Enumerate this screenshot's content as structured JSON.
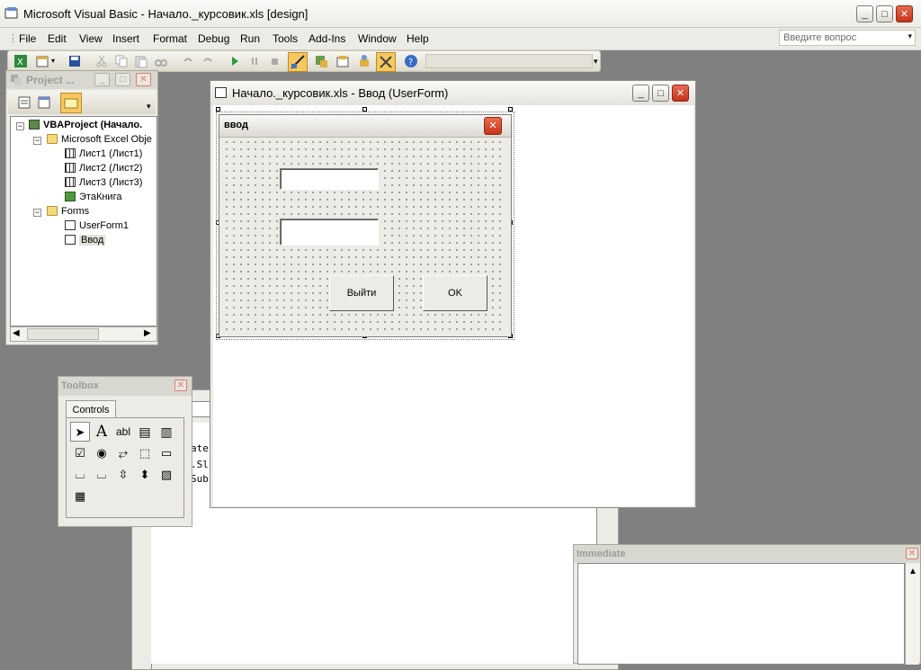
{
  "app": {
    "title": "Microsoft Visual Basic - Начало._курсовик.xls [design]"
  },
  "menu": {
    "items": [
      "File",
      "Edit",
      "View",
      "Insert",
      "Format",
      "Debug",
      "Run",
      "Tools",
      "Add-Ins",
      "Window",
      "Help"
    ],
    "ask_placeholder": "Введите вопрос"
  },
  "project": {
    "title": "Project ...",
    "tree": {
      "root": "VBAProject (Начало.",
      "excel_objects": "Microsoft Excel Obje",
      "sheet1": "Лист1 (Лист1)",
      "sheet2": "Лист2 (Лист2)",
      "sheet3": "Лист3 (Лист3)",
      "workbook": "ЭтаКнига",
      "forms": "Forms",
      "userform1": "UserForm1",
      "vvod": "Ввод"
    }
  },
  "designer": {
    "title": "Начало._курсовик.xls - Ввод (UserForm)",
    "form": {
      "caption": "ввод",
      "button_exit": "Выйти",
      "button_ok": "OK"
    }
  },
  "toolbox": {
    "title": "Toolbox",
    "tab": "Controls"
  },
  "code": {
    "lines": [
      "ate",
      ".Sl",
      "Sub"
    ]
  },
  "immediate": {
    "title": "Immediate"
  }
}
